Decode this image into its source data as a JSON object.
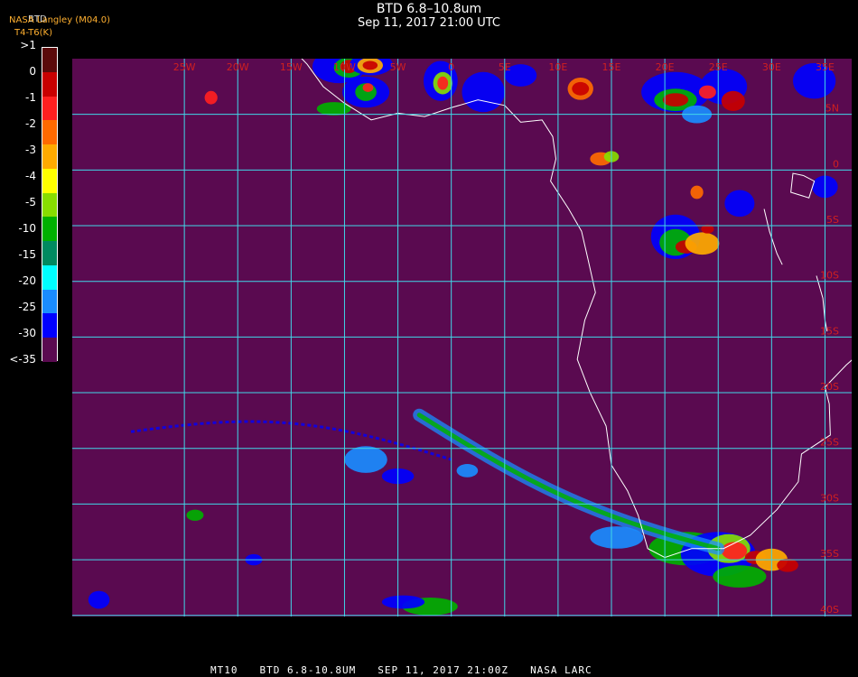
{
  "header": {
    "title": "BTD 6.8–10.8um",
    "subtitle": "Sep 11, 2017 21:00 UTC",
    "credit": "NASA Langley (M04.0)",
    "colorbar_title": "BTD",
    "units": "T4-T6(K)"
  },
  "colorbar": {
    "labels": [
      ">1",
      "0",
      "-1",
      "-2",
      "-3",
      "-4",
      "-5",
      "-10",
      "-15",
      "-20",
      "-25",
      "-30",
      "<-35"
    ],
    "colors": [
      "#5a0a0a",
      "#c80000",
      "#ff2020",
      "#ff6a00",
      "#ffaa00",
      "#ffff00",
      "#88dd00",
      "#00b000",
      "#008a60",
      "#00ffff",
      "#1a8cff",
      "#0000ff",
      "#5a0a50"
    ]
  },
  "map": {
    "background": "#5a0a50",
    "grid_color": "#40d8e8",
    "coast_color": "#ffffff",
    "label_color": "#d02020",
    "lon_labels": [
      "25W",
      "20W",
      "15W",
      "10W",
      "5W",
      "0",
      "5E",
      "10E",
      "15E",
      "20E",
      "25E",
      "30E",
      "35E"
    ],
    "lat_labels": [
      "5N",
      "0",
      "5S",
      "10S",
      "15S",
      "20S",
      "25S",
      "30S",
      "35S",
      "40S"
    ]
  },
  "footer": {
    "product": "MT10",
    "channel": "BTD 6.8-10.8UM",
    "datetime": "SEP 11, 2017 21:00Z",
    "source": "NASA LARC"
  }
}
